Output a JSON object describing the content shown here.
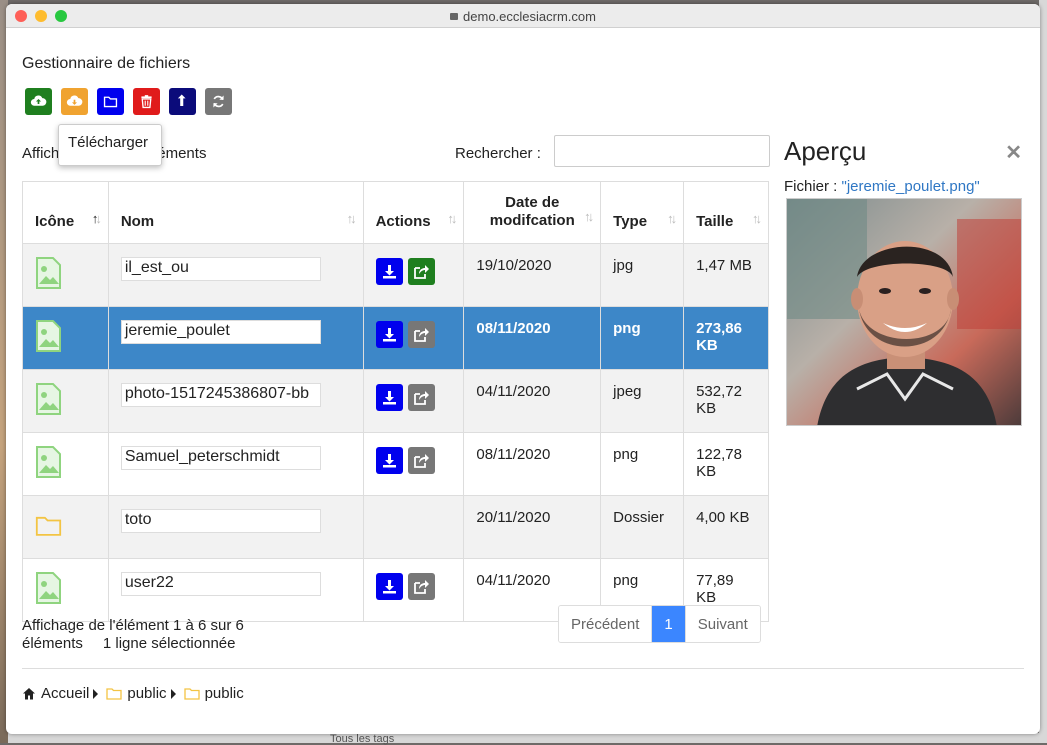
{
  "browser": {
    "url": "demo.ecclesiacrm.com"
  },
  "app": {
    "title": "Gestionnaire de fichiers"
  },
  "toolbar": {
    "buttons": [
      {
        "name": "upload",
        "icon": "cloud-upload-icon",
        "color": "#1f7f1f"
      },
      {
        "name": "download",
        "icon": "cloud-download-icon",
        "color": "#f0a330"
      },
      {
        "name": "new-folder",
        "icon": "folder-icon",
        "color": "#0000ee"
      },
      {
        "name": "delete",
        "icon": "trash-icon",
        "color": "#e01b1b"
      },
      {
        "name": "parent-folder",
        "icon": "level-up-icon",
        "color": "#0b0b7a"
      },
      {
        "name": "refresh",
        "icon": "refresh-icon",
        "color": "#777777"
      }
    ]
  },
  "tooltip": "Télécharger",
  "list": {
    "length_label_left": "Affich",
    "length_label_right": "éments",
    "search_label": "Rechercher :",
    "search_value": ""
  },
  "table": {
    "columns": [
      "Icône",
      "Nom",
      "Actions",
      "Date de modifcation",
      "Type",
      "Taille"
    ],
    "rows": [
      {
        "name": "il_est_ou",
        "icon": "image-file-icon",
        "date": "19/10/2020",
        "type": "jpg",
        "size": "1,47 MB",
        "selected": false,
        "share_green": true
      },
      {
        "name": "jeremie_poulet",
        "icon": "image-file-icon",
        "date": "08/11/2020",
        "type": "png",
        "size": "273,86 KB",
        "selected": true,
        "share_green": false
      },
      {
        "name": "photo-1517245386807-bb",
        "icon": "image-file-icon",
        "date": "04/11/2020",
        "type": "jpeg",
        "size": "532,72 KB",
        "selected": false,
        "share_green": false
      },
      {
        "name": "Samuel_peterschmidt",
        "icon": "image-file-icon",
        "date": "08/11/2020",
        "type": "png",
        "size": "122,78 KB",
        "selected": false,
        "share_green": false
      },
      {
        "name": "toto",
        "icon": "folder-icon",
        "date": "20/11/2020",
        "type": "Dossier",
        "size": "4,00 KB",
        "selected": false,
        "folder": true
      },
      {
        "name": "user22",
        "icon": "image-file-icon",
        "date": "04/11/2020",
        "type": "png",
        "size": "77,89 KB",
        "selected": false,
        "share_green": false
      }
    ]
  },
  "footer": {
    "info_line1": "Affichage de l'élément 1 à 6 sur 6",
    "info_line2": "éléments",
    "selected_info": "1 ligne sélectionnée",
    "prev": "Précédent",
    "page": "1",
    "next": "Suivant"
  },
  "breadcrumb": {
    "home": "Accueil",
    "items": [
      "public",
      "public"
    ]
  },
  "preview": {
    "title": "Aperçu",
    "file_label": "Fichier :",
    "file_name": "\"jeremie_poulet.png\""
  },
  "background": {
    "bottom_text": "Tous les tags"
  },
  "colors": {
    "selected_row": "#3d87c8",
    "link": "#2f77c4",
    "pager_active": "#3b86ff"
  }
}
